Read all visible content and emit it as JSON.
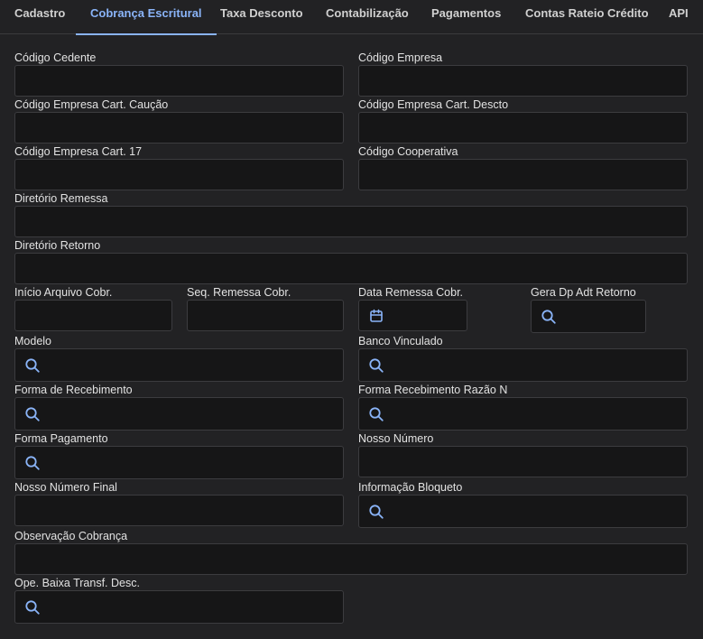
{
  "tabs": [
    {
      "label": "Cadastro"
    },
    {
      "label": "Cobrança Escritural"
    },
    {
      "label": "Taxa Desconto"
    },
    {
      "label": "Contabilização"
    },
    {
      "label": "Pagamentos"
    },
    {
      "label": "Contas Rateio Crédito"
    },
    {
      "label": "API"
    }
  ],
  "fields": {
    "codigo_cedente": {
      "label": "Código Cedente",
      "value": ""
    },
    "codigo_empresa": {
      "label": "Código Empresa",
      "value": ""
    },
    "codigo_empresa_caucao": {
      "label": "Código Empresa Cart. Caução",
      "value": ""
    },
    "codigo_empresa_descto": {
      "label": "Código Empresa Cart. Descto",
      "value": ""
    },
    "codigo_empresa_17": {
      "label": "Código Empresa Cart. 17",
      "value": ""
    },
    "codigo_cooperativa": {
      "label": "Código Cooperativa",
      "value": ""
    },
    "diretorio_remessa": {
      "label": "Diretório Remessa",
      "value": ""
    },
    "diretorio_retorno": {
      "label": "Diretório Retorno",
      "value": ""
    },
    "inicio_arquivo": {
      "label": "Início Arquivo Cobr.",
      "value": ""
    },
    "seq_remessa": {
      "label": "Seq. Remessa Cobr.",
      "value": ""
    },
    "data_remessa": {
      "label": "Data Remessa Cobr.",
      "value": ""
    },
    "gera_dp": {
      "label": "Gera Dp Adt Retorno",
      "value": ""
    },
    "modelo": {
      "label": "Modelo",
      "value": ""
    },
    "banco_vinculado": {
      "label": "Banco Vinculado",
      "value": ""
    },
    "forma_recebimento": {
      "label": "Forma de Recebimento",
      "value": ""
    },
    "forma_recebimento_razao": {
      "label": "Forma Recebimento Razão N",
      "value": ""
    },
    "forma_pagamento": {
      "label": "Forma Pagamento",
      "value": ""
    },
    "nosso_numero": {
      "label": "Nosso Número",
      "value": ""
    },
    "nosso_numero_final": {
      "label": "Nosso Número Final",
      "value": ""
    },
    "informacao_bloqueto": {
      "label": "Informação Bloqueto",
      "value": ""
    },
    "observacao_cobranca": {
      "label": "Observação Cobrança",
      "value": ""
    },
    "ope_baixa": {
      "label": "Ope. Baixa Transf. Desc.",
      "value": ""
    }
  },
  "colors": {
    "accent": "#8ab4f8",
    "background": "#222224",
    "input": "#161617"
  },
  "icons": {
    "lookup": "search-icon",
    "date": "calendar-icon"
  }
}
